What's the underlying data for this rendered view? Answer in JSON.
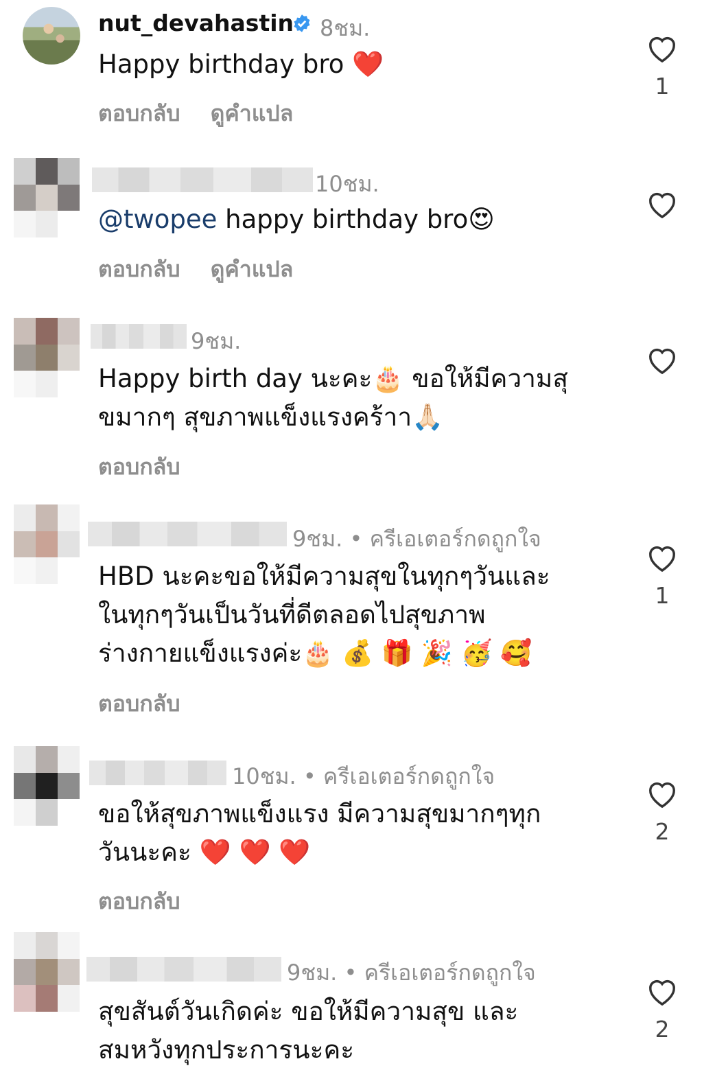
{
  "comments": [
    {
      "username": "nut_devahastin",
      "time": "8ชม.",
      "text": "Happy birthday bro ❤️",
      "actions": [
        "ตอบกลับ",
        "ดูคำแปล"
      ],
      "likes": "1"
    },
    {
      "time": "10ชม.",
      "mention": "@twopee",
      "text": " happy birthday bro😍",
      "actions": [
        "ตอบกลับ",
        "ดูคำแปล"
      ],
      "likes": ""
    },
    {
      "time": "9ชม.",
      "text": "Happy birth day นะคะ🎂 ขอให้มีความสุ\nขมากๆ สุขภาพแข็งแรงคร้าา🙏🏻",
      "actions": [
        "ตอบกลับ"
      ],
      "likes": ""
    },
    {
      "time": "9ชม. • ครีเอเตอร์กดถูกใจ",
      "text": "HBD นะคะขอให้มีความสุขในทุกๆวันและ\nในทุกๆวันเป็นวันที่ดีตลอดไปสุขภาพ\nร่างกายแข็งแรงค่ะ🎂 💰 🎁 🎉 🥳 🥰",
      "actions": [
        "ตอบกลับ"
      ],
      "likes": "1"
    },
    {
      "time": "10ชม. • ครีเอเตอร์กดถูกใจ",
      "text": "ขอให้สุขภาพแข็งแรง มีความสุขมากๆทุก\nวันนะคะ ❤️ ❤️ ❤️",
      "actions": [
        "ตอบกลับ"
      ],
      "likes": "2"
    },
    {
      "time": "9ชม. • ครีเอเตอร์กดถูกใจ",
      "text": "สุขสันต์วันเกิดค่ะ ขอให้มีความสุข และ\nสมหวังทุกประการนะคะ",
      "actions": [],
      "likes": "2"
    }
  ],
  "colors": {
    "secondary_text": "#8e8e8e",
    "mention": "#1a3d6b",
    "verified": "#3897f0"
  }
}
